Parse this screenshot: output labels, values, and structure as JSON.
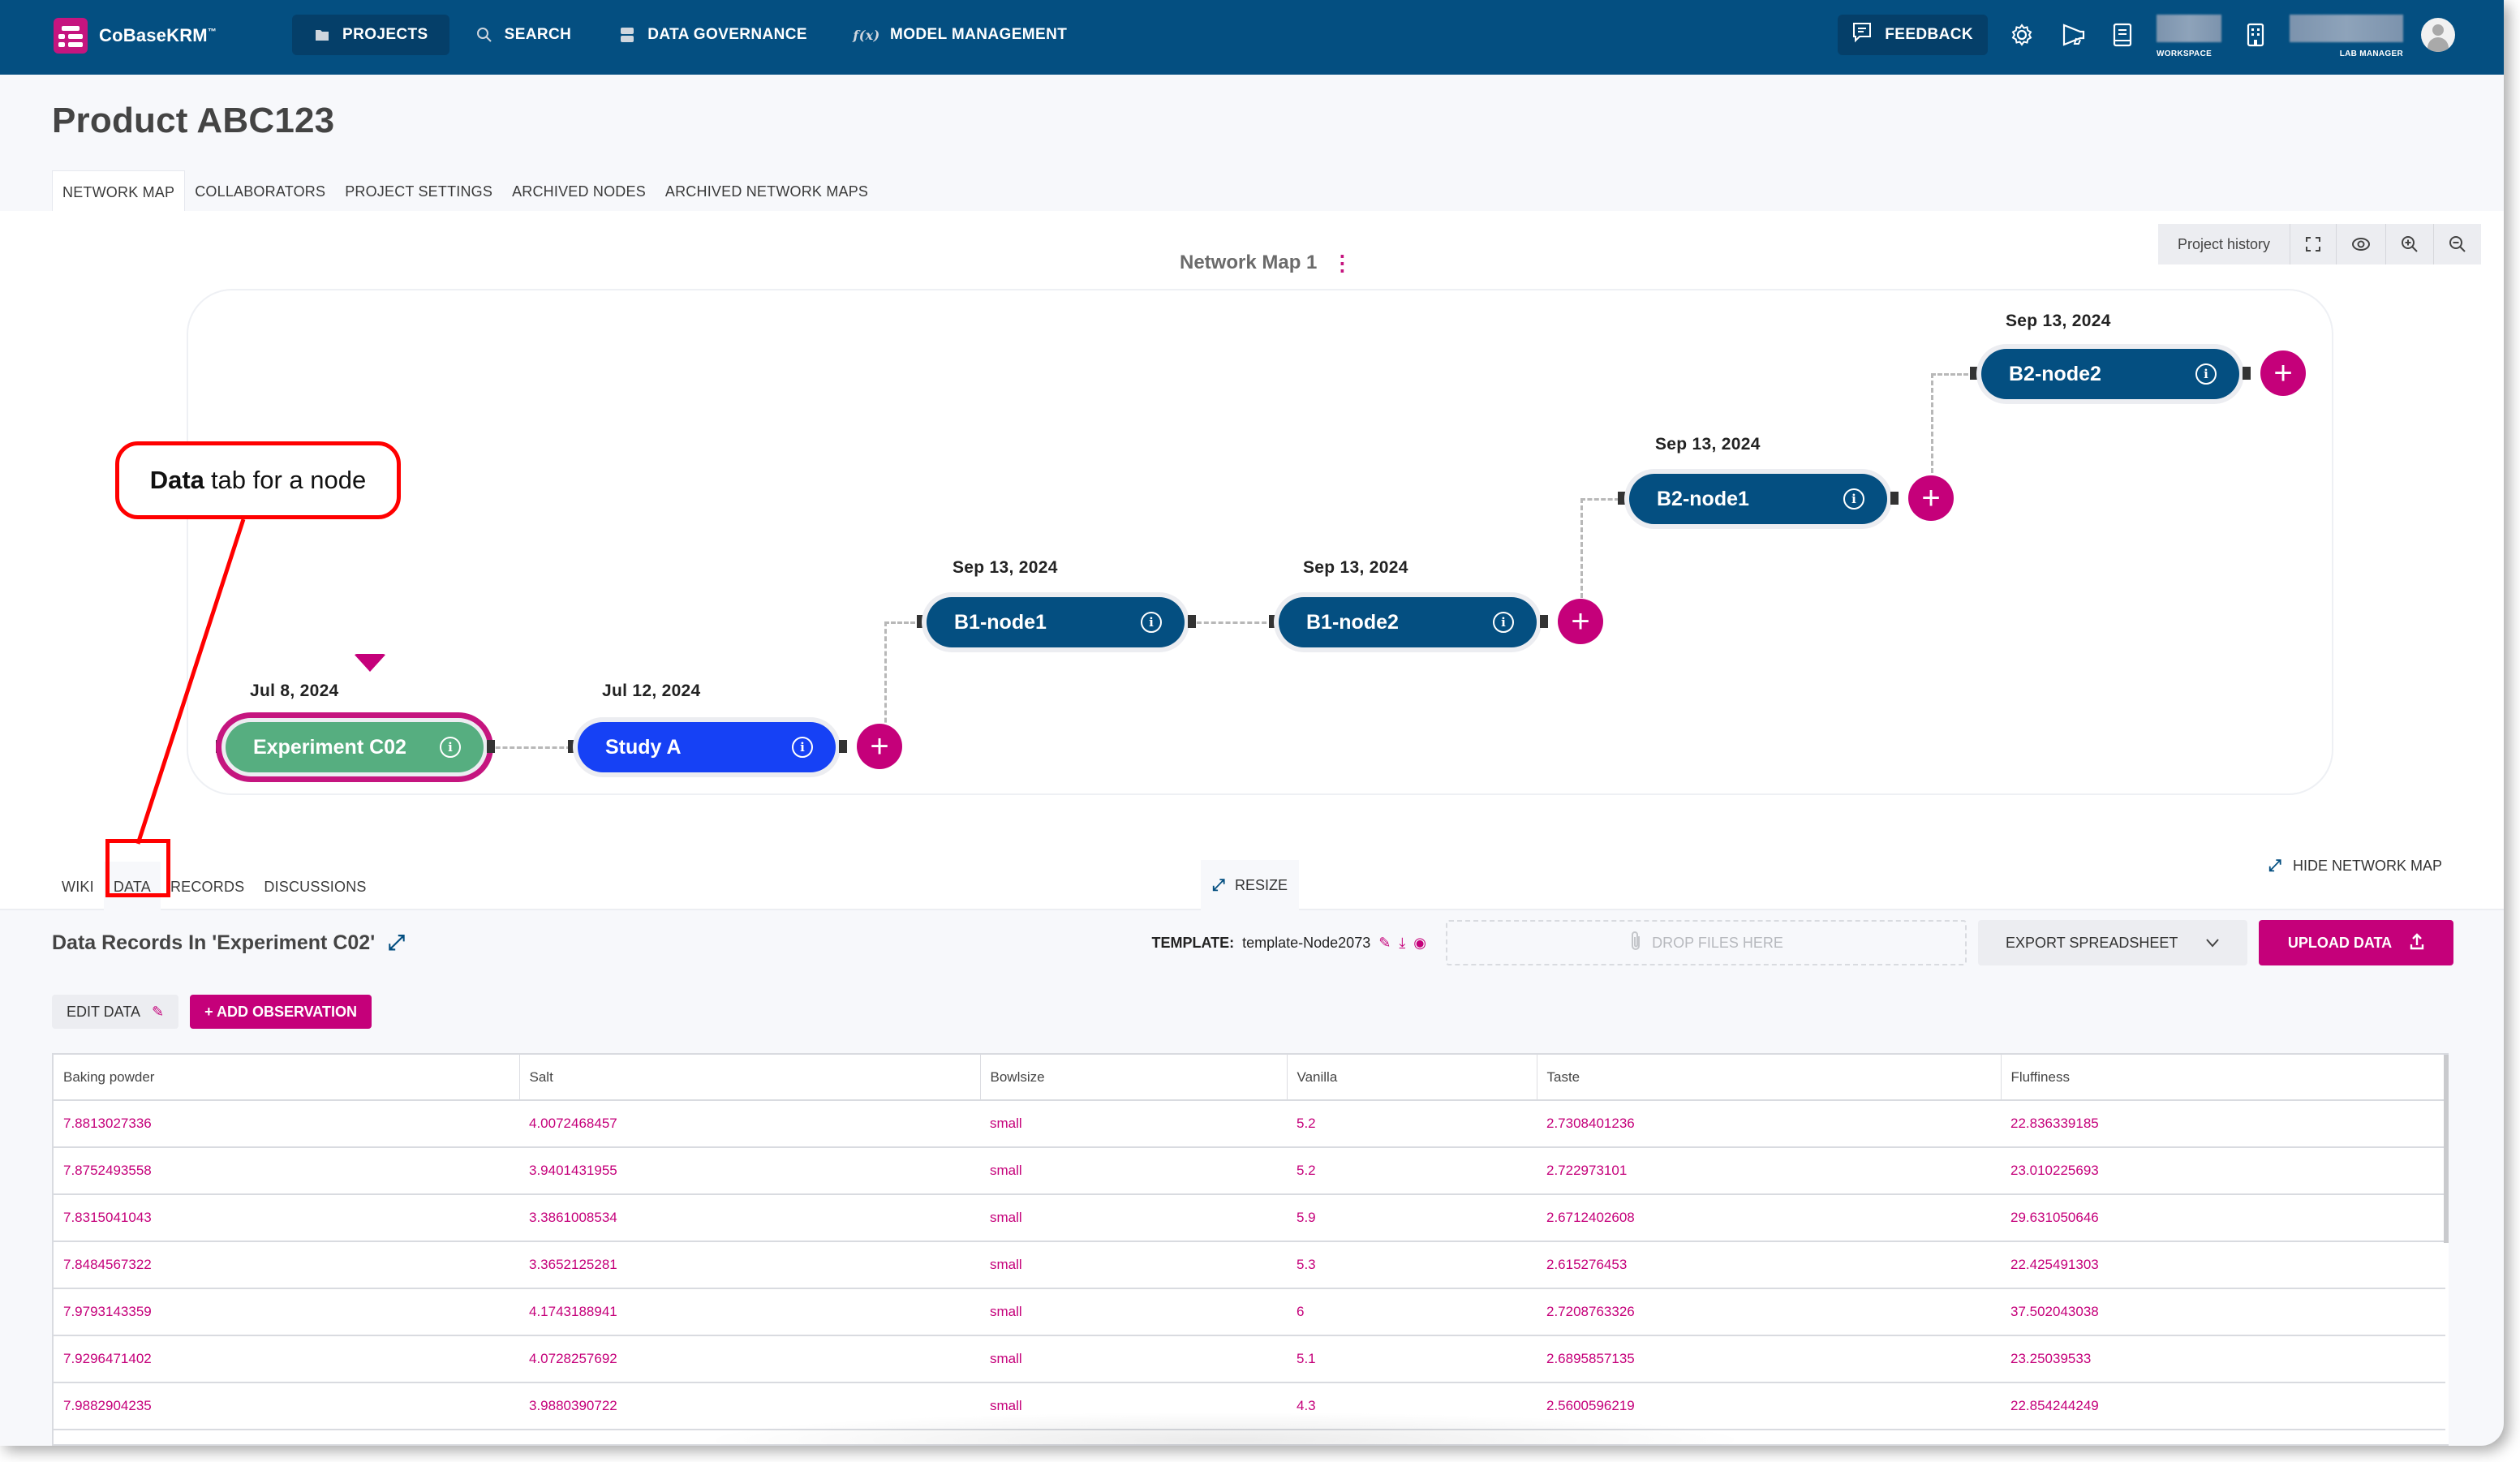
{
  "app": {
    "name": "CoBaseKRM",
    "trademark": "™"
  },
  "topnav": {
    "items": [
      {
        "label": "PROJECTS",
        "icon": "folder-icon",
        "active": true
      },
      {
        "label": "SEARCH",
        "icon": "search-icon",
        "active": false
      },
      {
        "label": "DATA GOVERNANCE",
        "icon": "database-icon",
        "active": false
      },
      {
        "label": "MODEL MANAGEMENT",
        "icon": "function-icon",
        "active": false
      }
    ],
    "feedback_label": "FEEDBACK",
    "workspace_caption": "WORKSPACE",
    "user_role_caption": "LAB MANAGER"
  },
  "project": {
    "title": "Product ABC123",
    "tabs": [
      {
        "label": "NETWORK MAP",
        "active": true
      },
      {
        "label": "COLLABORATORS",
        "active": false
      },
      {
        "label": "PROJECT SETTINGS",
        "active": false
      },
      {
        "label": "ARCHIVED NODES",
        "active": false
      },
      {
        "label": "ARCHIVED NETWORK MAPS",
        "active": false
      }
    ]
  },
  "network_map": {
    "title": "Network Map 1",
    "tools": {
      "history_label": "Project history",
      "icons": [
        "fullscreen-icon",
        "eye-icon",
        "zoom-in-icon",
        "zoom-out-icon"
      ]
    },
    "nodes": [
      {
        "id": "exp-c02",
        "label": "Experiment C02",
        "date": "Jul 8, 2024",
        "style": "green",
        "selected": true
      },
      {
        "id": "study-a",
        "label": "Study A",
        "date": "Jul 12, 2024",
        "style": "blue"
      },
      {
        "id": "b1n1",
        "label": "B1-node1",
        "date": "Sep 13, 2024",
        "style": "dark"
      },
      {
        "id": "b1n2",
        "label": "B1-node2",
        "date": "Sep 13, 2024",
        "style": "dark"
      },
      {
        "id": "b2n1",
        "label": "B2-node1",
        "date": "Sep 13, 2024",
        "style": "dark"
      },
      {
        "id": "b2n2",
        "label": "B2-node2",
        "date": "Sep 13, 2024",
        "style": "dark"
      }
    ],
    "add_symbol": "+",
    "info_symbol": "i"
  },
  "annotation": {
    "bold": "Data",
    "rest": "tab for a node"
  },
  "node_tabs": {
    "items": [
      {
        "label": "WIKI",
        "active": false
      },
      {
        "label": "DATA",
        "active": true
      },
      {
        "label": "RECORDS",
        "active": false
      },
      {
        "label": "DISCUSSIONS",
        "active": false
      }
    ],
    "resize_label": "RESIZE",
    "hide_map_label": "HIDE NETWORK MAP"
  },
  "data_section": {
    "title": "Data Records In 'Experiment C02'",
    "template_prefix": "TEMPLATE:",
    "template_name": "template-Node2073",
    "dropzone_label": "DROP FILES HERE",
    "export_label": "EXPORT SPREADSHEET",
    "upload_label": "UPLOAD DATA",
    "edit_label": "EDIT DATA",
    "add_observation_label": "+ ADD OBSERVATION"
  },
  "table": {
    "columns": [
      "Baking powder",
      "Salt",
      "Bowlsize",
      "Vanilla",
      "Taste",
      "Fluffiness"
    ],
    "rows": [
      [
        "7.8813027336",
        "4.0072468457",
        "small",
        "5.2",
        "2.7308401236",
        "22.836339185"
      ],
      [
        "7.8752493558",
        "3.9401431955",
        "small",
        "5.2",
        "2.722973101",
        "23.010225693"
      ],
      [
        "7.8315041043",
        "3.3861008534",
        "small",
        "5.9",
        "2.6712402608",
        "29.631050646"
      ],
      [
        "7.8484567322",
        "3.3652125281",
        "small",
        "5.3",
        "2.615276453",
        "22.425491303"
      ],
      [
        "7.9793143359",
        "4.1743188941",
        "small",
        "6",
        "2.7208763326",
        "37.502043038"
      ],
      [
        "7.9296471402",
        "4.0728257692",
        "small",
        "5.1",
        "2.6895857135",
        "23.25039533"
      ],
      [
        "7.9882904235",
        "3.9880390722",
        "small",
        "4.3",
        "2.5600596219",
        "22.854244249"
      ]
    ]
  },
  "colors": {
    "header_bg": "#044f81",
    "accent": "#c5007a",
    "node_dark": "#044f81",
    "node_blue": "#1641f5",
    "node_green": "#56ae80",
    "annotation_red": "#ff0000"
  }
}
